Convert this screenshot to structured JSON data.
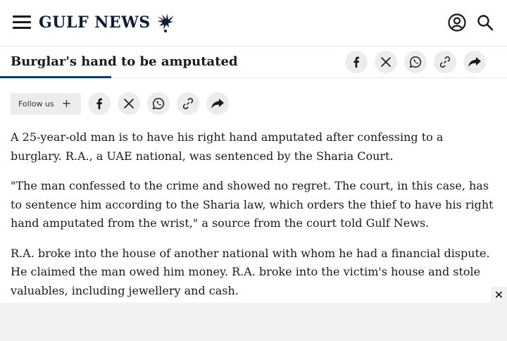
{
  "header": {
    "logo_text": "GULF NEWS",
    "icons": [
      "menu-icon",
      "falcon-logo-icon",
      "account-icon",
      "search-icon"
    ]
  },
  "sticky": {
    "title": "Burglar's hand to be amputated",
    "read_progress_fraction": 0.22,
    "share_icons": [
      "facebook-icon",
      "x-icon",
      "whatsapp-icon",
      "copy-link-icon",
      "share-icon"
    ]
  },
  "share_row": {
    "follow_label": "Follow us",
    "follow_icon": "plus-icon",
    "share_icons": [
      "facebook-icon",
      "x-icon",
      "whatsapp-icon",
      "copy-link-icon",
      "share-icon"
    ]
  },
  "article": {
    "paragraphs": [
      "A 25-year-old man is to have his right hand amputated after confessing to a burglary. R.A., a UAE national, was sentenced by the Sharia Court.",
      "\"The man confessed to the crime and showed no regret. The court, in this case, has to sentence him according to the Sharia law, which orders the thief to have his right hand amputated from the wrist,\" a source from the court told Gulf News.",
      "R.A. broke into the house of another national with whom he had a financial dispute. He claimed the man owed him money. R.A. broke into the victim's house and stole valuables, including jewellery and cash."
    ]
  },
  "ad": {
    "close_label": "✕"
  },
  "colors": {
    "brand_navy": "#0b1d35",
    "progress": "#0b3c6e",
    "button_bg": "#ececec"
  }
}
